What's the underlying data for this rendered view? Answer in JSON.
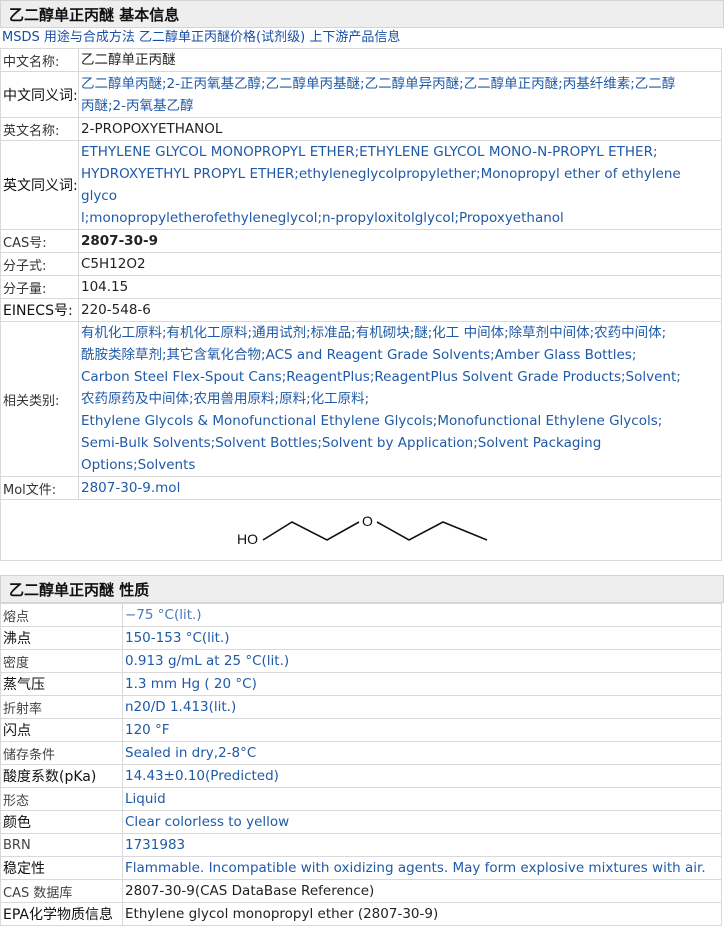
{
  "basic": {
    "title": "乙二醇单正丙醚 基本信息",
    "links": [
      "MSDS",
      "用途与合成方法",
      "乙二醇单正丙醚价格(试剂级)",
      "上下游产品信息"
    ],
    "rows": {
      "cn_name": {
        "label": "中文名称:",
        "value": "乙二醇单正丙醚"
      },
      "cn_syn": {
        "label": "中文同义词:",
        "line1": "乙二醇单丙醚;2-正丙氧基乙醇;乙二醇单丙基醚;乙二醇单异丙醚;乙二醇单正丙醚;丙基纤维素;乙二醇",
        "line2": "丙醚;2-丙氧基乙醇"
      },
      "en_name": {
        "label": "英文名称:",
        "value": "2-PROPOXYETHANOL"
      },
      "en_syn": {
        "label": "英文同义词:",
        "line1": "ETHYLENE GLYCOL MONOPROPYL ETHER;ETHYLENE GLYCOL MONO-N-PROPYL ETHER;",
        "line2": "HYDROXYETHYL PROPYL ETHER;ethyleneglycolpropylether;Monopropyl ether of ethylene glyco",
        "line3": "l;monopropyletherofethyleneglycol;n-propyloxitolglycol;Propoxyethanol"
      },
      "cas": {
        "label": "CAS号:",
        "value": "2807-30-9"
      },
      "formula": {
        "label": "分子式:",
        "value": "C5H12O2"
      },
      "mw": {
        "label": "分子量:",
        "value": "104.15"
      },
      "einecs": {
        "label": "EINECS号:",
        "value": "220-548-6"
      },
      "category": {
        "label": "相关类别:",
        "lines": [
          "有机化工原料;有机化工原料;通用试剂;标准品;有机砌块;醚;化工 中间体;除草剂中间体;农药中间体;",
          "酰胺类除草剂;其它含氧化合物;ACS and Reagent Grade Solvents;Amber Glass Bottles;",
          "Carbon Steel Flex-Spout Cans;ReagentPlus;ReagentPlus Solvent Grade Products;Solvent;",
          "农药原药及中间体;农用兽用原料;原料;化工原料;",
          "Ethylene Glycols & Monofunctional Ethylene Glycols;Monofunctional Ethylene Glycols;",
          "Semi-Bulk Solvents;Solvent Bottles;Solvent by Application;Solvent Packaging Options;Solvents"
        ]
      },
      "mol": {
        "label": "Mol文件:",
        "value": "2807-30-9.mol"
      }
    },
    "structure_label": "HO",
    "structure_o": "O"
  },
  "properties": {
    "title": "乙二醇单正丙醚 性质",
    "rows": [
      {
        "label": "熔点",
        "value": "−75 °C(lit.)",
        "style": "pale"
      },
      {
        "label": "沸点",
        "value": "150-153 °C(lit.)",
        "style": "blue",
        "big": true
      },
      {
        "label": "密度",
        "value": "0.913 g/mL at 25 °C(lit.)",
        "style": "blue"
      },
      {
        "label": "蒸气压",
        "value": "1.3 mm Hg ( 20 °C)",
        "style": "blue",
        "big": true
      },
      {
        "label": "折射率",
        "value": "n20/D 1.413(lit.)",
        "style": "blue"
      },
      {
        "label": "闪点",
        "value": "120 °F",
        "style": "blue",
        "big": true
      },
      {
        "label": "储存条件",
        "value": "Sealed in dry,2-8°C",
        "style": "blue"
      },
      {
        "label": "酸度系数(pKa)",
        "value": "14.43±0.10(Predicted)",
        "style": "blue",
        "big": true
      },
      {
        "label": "形态",
        "value": "Liquid",
        "style": "blue"
      },
      {
        "label": "颜色",
        "value": "Clear colorless to yellow",
        "style": "blue",
        "big": true
      },
      {
        "label": "BRN",
        "value": "1731983",
        "style": "blue"
      },
      {
        "label": "稳定性",
        "value": "Flammable. Incompatible with oxidizing agents. May form explosive mixtures with air.",
        "style": "blue",
        "big": true
      },
      {
        "label": "CAS 数据库",
        "value": "2807-30-9(CAS DataBase Reference)",
        "style": "dark"
      },
      {
        "label": "EPA化学物质信息",
        "value": "Ethylene glycol monopropyl ether (2807-30-9)",
        "style": "dark",
        "big": true
      }
    ]
  }
}
